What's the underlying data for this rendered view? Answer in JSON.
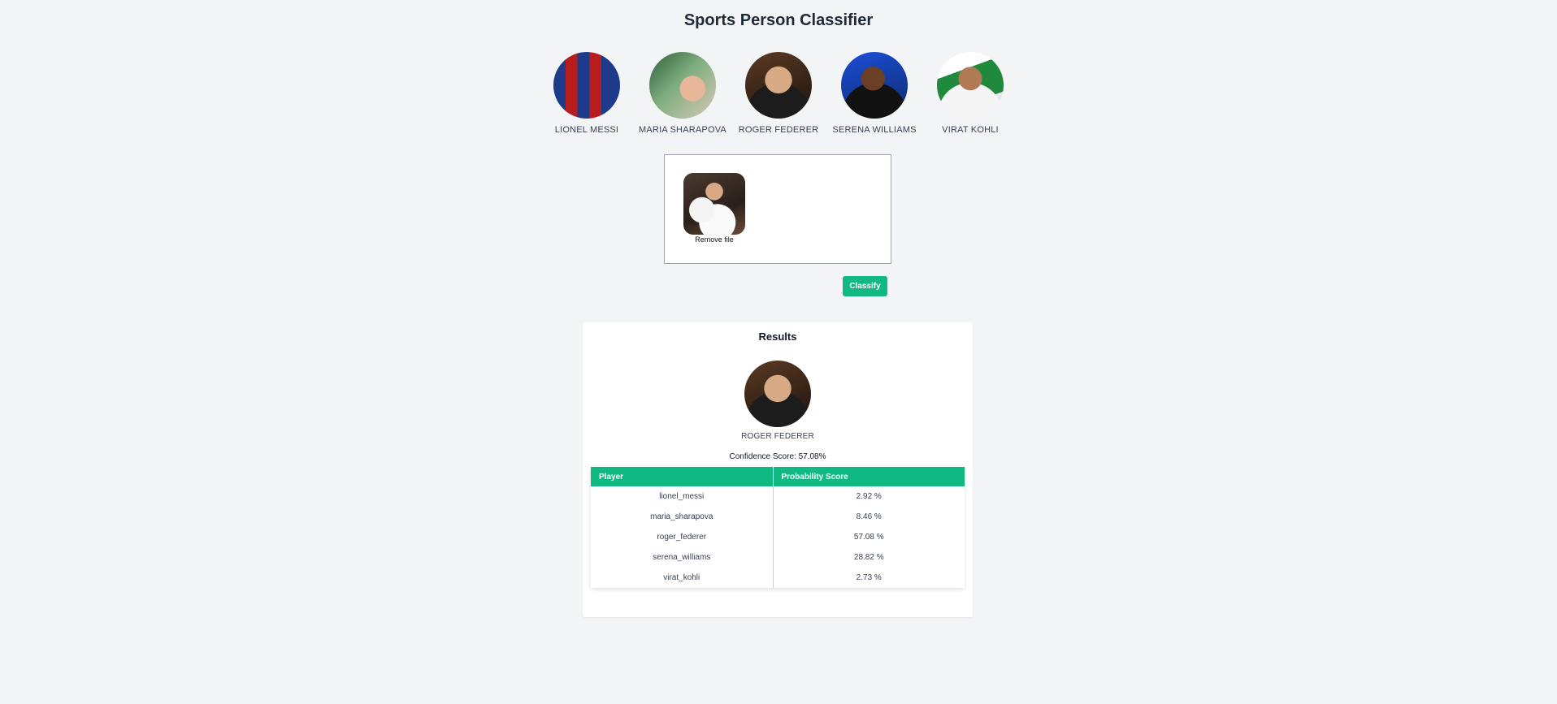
{
  "app": {
    "title": "Sports Person Classifier"
  },
  "players": [
    {
      "name": "LIONEL MESSI",
      "icon": "messi-photo"
    },
    {
      "name": "MARIA SHARAPOVA",
      "icon": "sharapova-photo"
    },
    {
      "name": "ROGER FEDERER",
      "icon": "federer-photo"
    },
    {
      "name": "SERENA WILLIAMS",
      "icon": "serena-photo"
    },
    {
      "name": "VIRAT KOHLI",
      "icon": "kohli-photo"
    }
  ],
  "upload": {
    "remove_label": "Remove file"
  },
  "actions": {
    "classify_label": "Classify"
  },
  "results": {
    "title": "Results",
    "predicted_name": "ROGER FEDERER",
    "confidence_text": "Confidence Score: 57.08%",
    "table": {
      "headers": [
        "Player",
        "Probability Score"
      ],
      "rows": [
        {
          "player": "lionel_messi",
          "score": "2.92 %"
        },
        {
          "player": "maria_sharapova",
          "score": "8.46 %"
        },
        {
          "player": "roger_federer",
          "score": "57.08 %"
        },
        {
          "player": "serena_williams",
          "score": "28.82 %"
        },
        {
          "player": "virat_kohli",
          "score": "2.73 %"
        }
      ]
    }
  },
  "colors": {
    "accent": "#10b981",
    "background": "#f3f4f6"
  }
}
